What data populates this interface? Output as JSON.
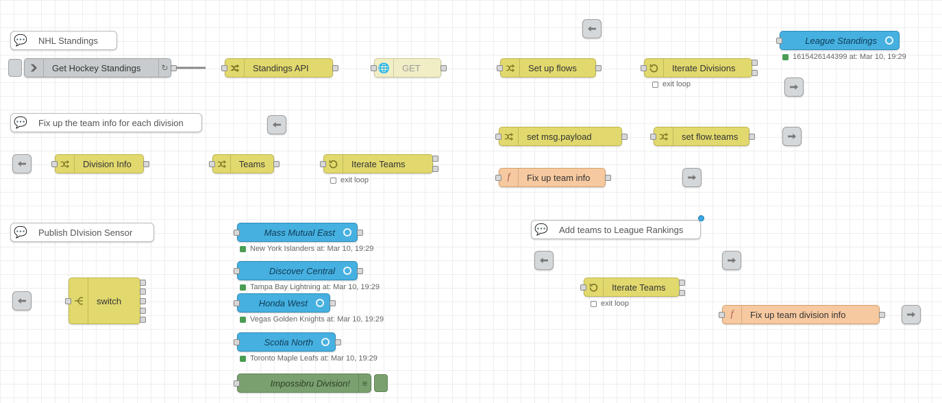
{
  "comments": {
    "c1": "NHL Standings",
    "c2": "Fix up the team info for each division",
    "c3": "Publish DIvision Sensor",
    "c4": "Add teams to League Rankings"
  },
  "nodes": {
    "get_hockey": "Get Hockey Standings",
    "standings_api": "Standings API",
    "http_get": "GET",
    "set_up_flows": "Set up flows",
    "iterate_divisions": "Iterate Divisions",
    "league_standings": "League Standings",
    "division_info": "Division Info",
    "teams": "Teams",
    "iterate_teams_1": "Iterate Teams",
    "set_msg_payload": "set msg.payload",
    "set_flow_teams": "set flow.teams",
    "fix_team_info": "Fix up team info",
    "switch": "switch",
    "mass_mutual_east": "Mass Mutual East",
    "discover_central": "Discover Central",
    "honda_west": "Honda West",
    "scotia_north": "Scotia North",
    "impossibru": "Impossibru Division!",
    "iterate_teams_2": "Iterate Teams",
    "fix_team_div_info": "Fix up team division info"
  },
  "status": {
    "league_standings": "1615426144399 at: Mar 10, 19:29",
    "exit_loop_1": "exit loop",
    "exit_loop_2": "exit loop",
    "exit_loop_3": "exit loop",
    "mass_mutual_east": "New York Islanders at: Mar 10, 19:29",
    "discover_central": "Tampa Bay Lightning at: Mar 10, 19:29",
    "honda_west": "Vegas Golden Knights at: Mar 10, 19:29",
    "scotia_north": "Toronto Maple Leafs at: Mar 10, 19:29"
  },
  "colors": {
    "blue": "#46b0e0",
    "yellow": "#e2d96e",
    "orange": "#f7c9a0",
    "green": "#7aa06f",
    "grey": "#c8ccce"
  },
  "icons": {
    "comment": "speech-bubble",
    "inject": "arrow-right-box",
    "change": "shuffle",
    "http": "globe",
    "loop": "refresh",
    "function": "f-italic",
    "debug": "list",
    "link": "jump-arrow",
    "switch": "switch"
  }
}
